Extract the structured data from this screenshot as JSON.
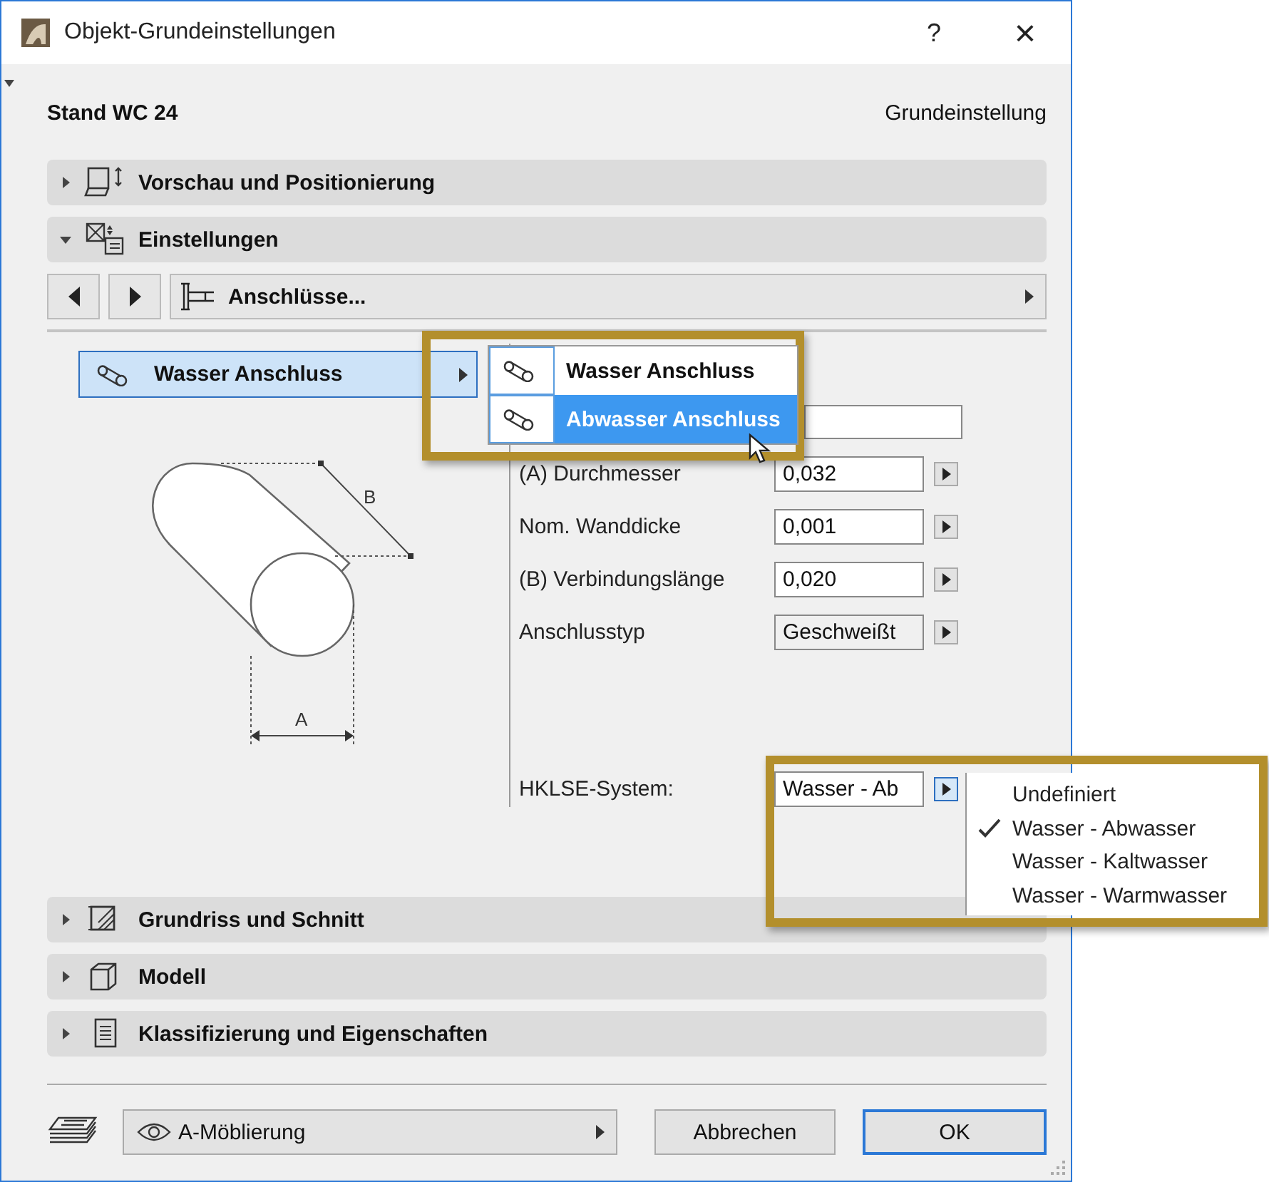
{
  "window": {
    "title": "Objekt-Grundeinstellungen",
    "help": "?",
    "close": "×"
  },
  "header": {
    "name": "Stand WC 24",
    "preset": "Grundeinstellung"
  },
  "panels": [
    {
      "label": "Vorschau und Positionierung",
      "expanded": false,
      "kind": "preview"
    },
    {
      "label": "Einstellungen",
      "expanded": true,
      "kind": "settings"
    },
    {
      "label": "Grundriss und Schnitt",
      "expanded": false,
      "kind": "plan"
    },
    {
      "label": "Modell",
      "expanded": false,
      "kind": "model"
    },
    {
      "label": "Klassifizierung und Eigenschaften",
      "expanded": false,
      "kind": "list"
    }
  ],
  "settings": {
    "page": "Anschlüsse...",
    "list_item": "Wasser Anschluss",
    "diagram_labels": {
      "a": "A",
      "b": "B"
    },
    "fields": [
      {
        "label": "(A) Durchmesser",
        "value": "0,032",
        "kind": "input"
      },
      {
        "label": "Nom. Wanddicke",
        "value": "0,001",
        "kind": "input"
      },
      {
        "label": "(B) Verbindungslänge",
        "value": "0,020",
        "kind": "input"
      },
      {
        "label": "Anschlusstyp",
        "value": "Geschweißt",
        "kind": "popup"
      }
    ],
    "system": {
      "label": "HKLSE-System:",
      "value": "Wasser - Ab"
    }
  },
  "connection_menu": {
    "items": [
      {
        "label": "Wasser Anschluss",
        "selected": false
      },
      {
        "label": "Abwasser Anschluss",
        "selected": true
      }
    ]
  },
  "system_menu": {
    "items": [
      {
        "label": "Undefiniert",
        "checked": false
      },
      {
        "label": "Wasser - Abwasser",
        "checked": true
      },
      {
        "label": "Wasser - Kaltwasser",
        "checked": false
      },
      {
        "label": "Wasser - Warmwasser",
        "checked": false
      }
    ]
  },
  "footer": {
    "layer": "A-Möblierung",
    "cancel": "Abbrechen",
    "ok": "OK"
  }
}
